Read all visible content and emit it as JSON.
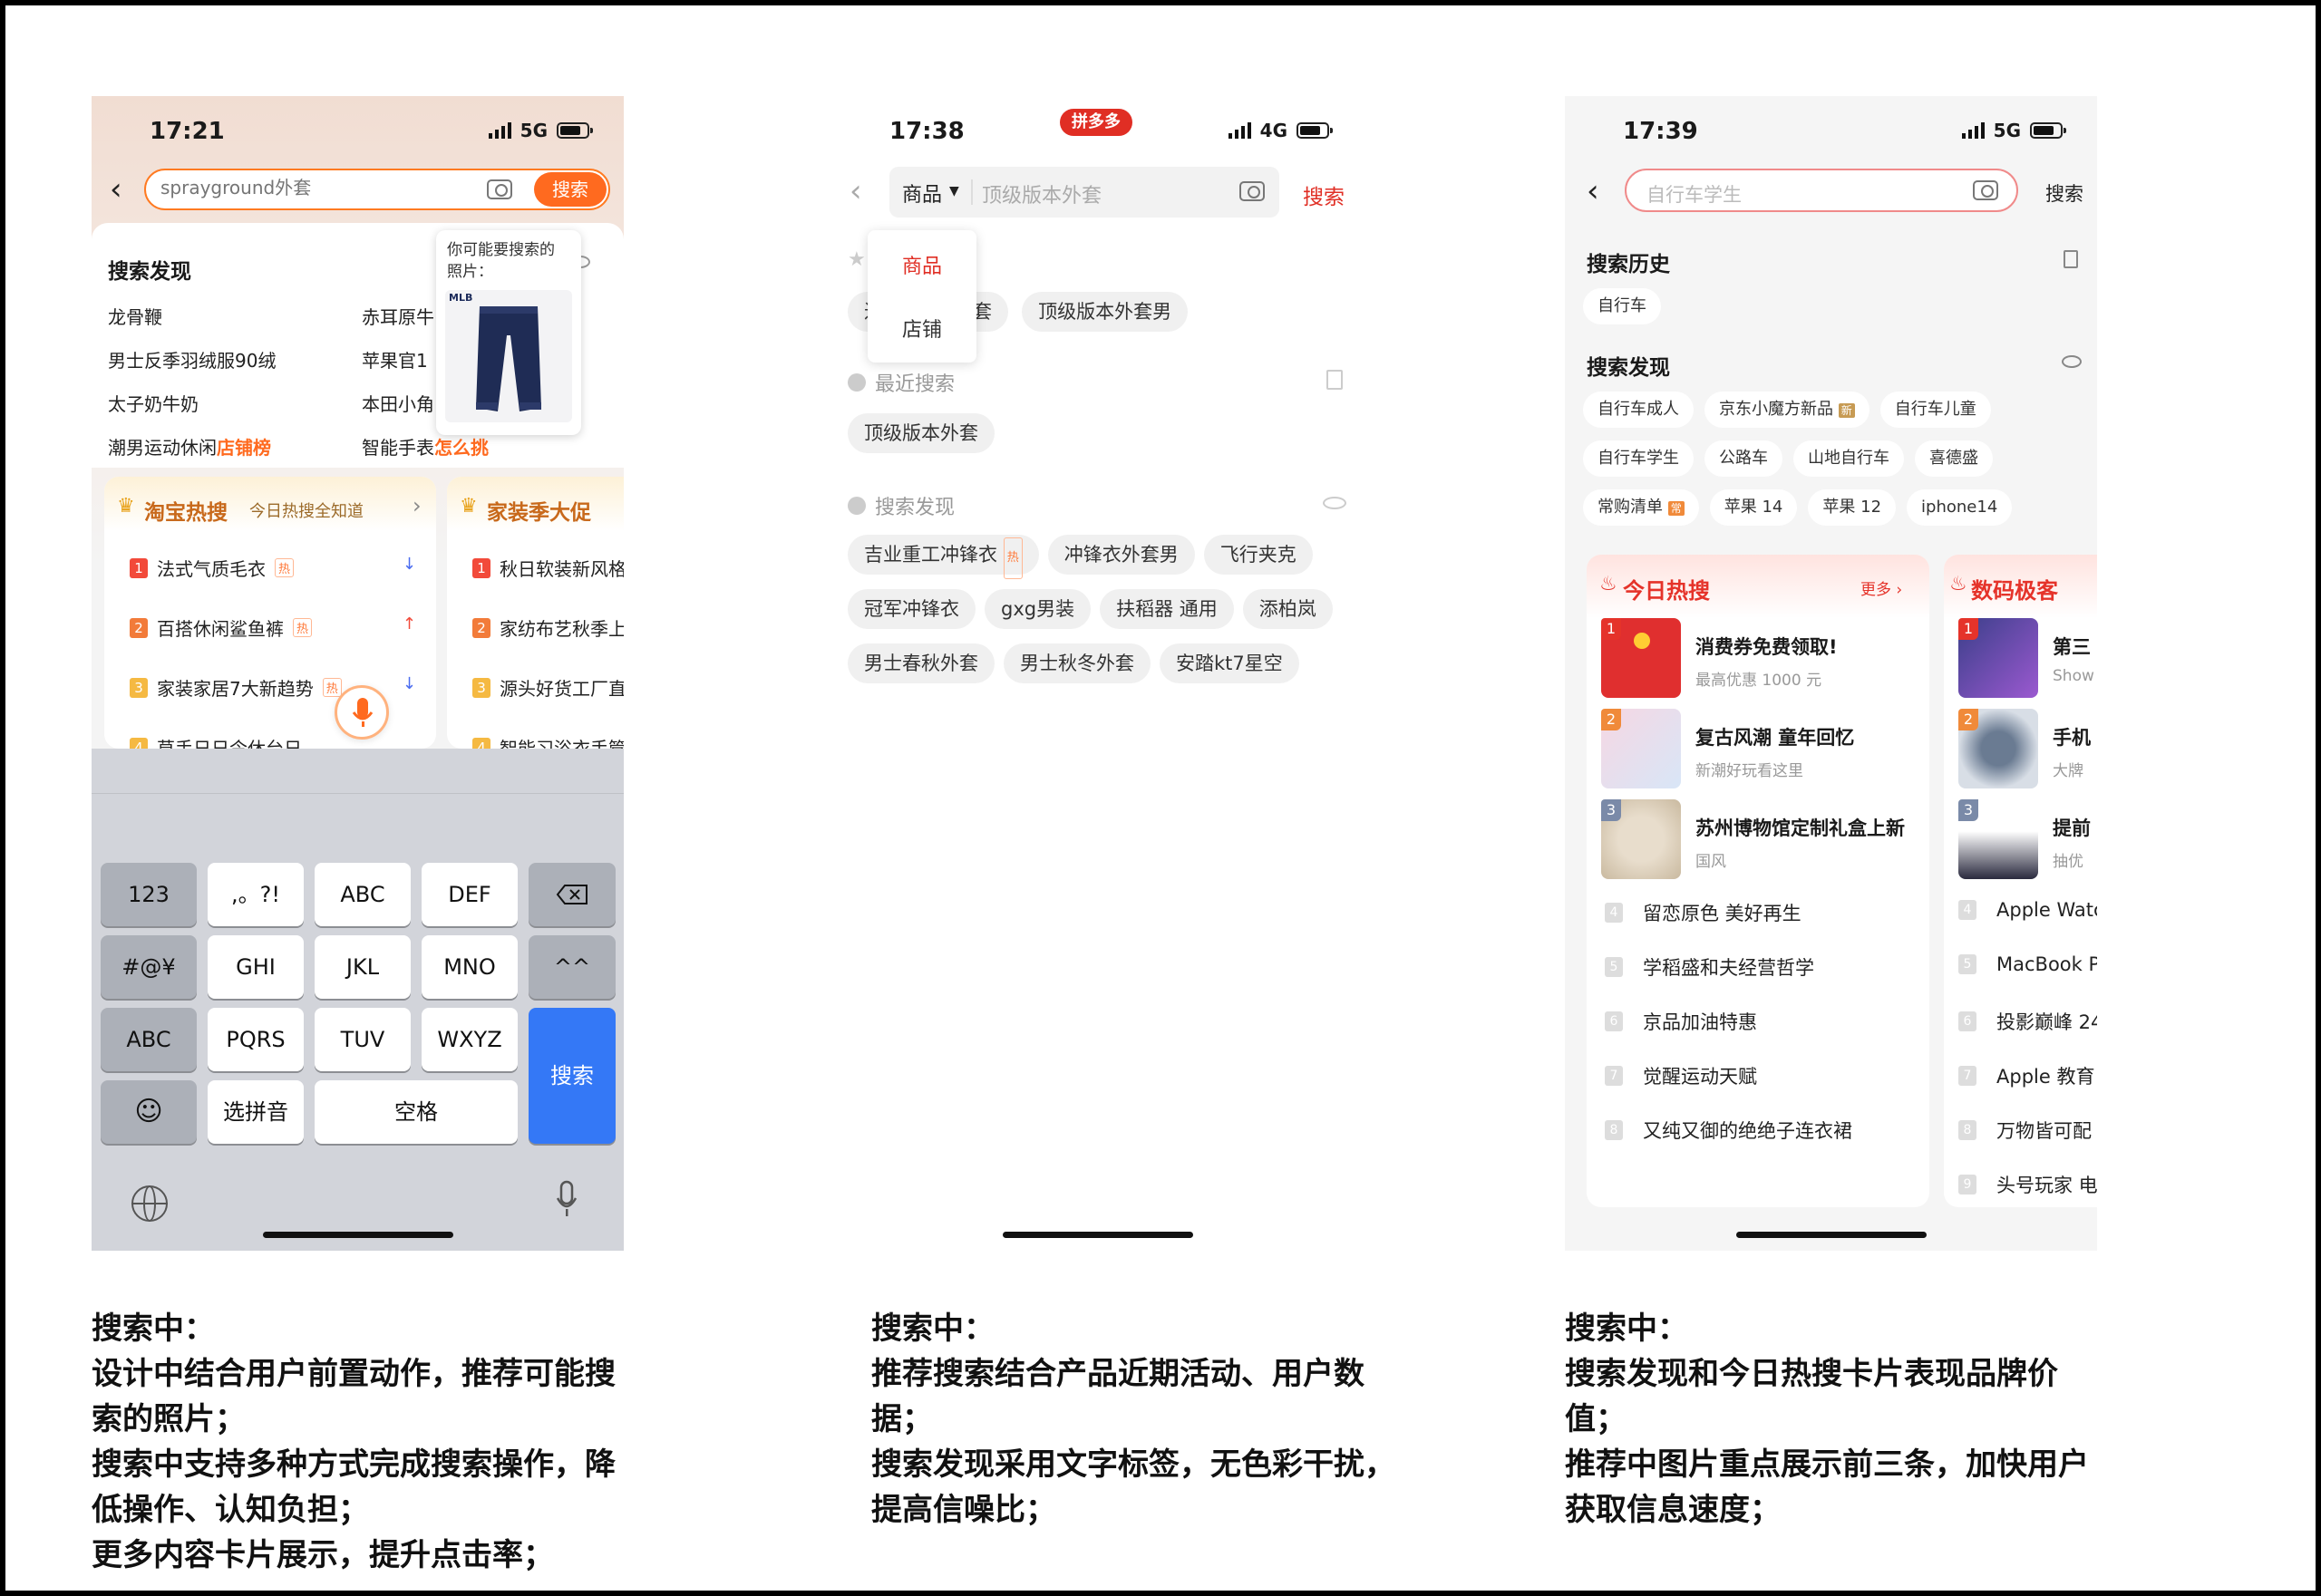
{
  "p1": {
    "time": "17:21",
    "network": "5G",
    "search_placeholder": "sprayground外套",
    "search_button": "搜索",
    "discover_title": "搜索发现",
    "discover_left": [
      "龙骨鞭",
      "男士反季羽绒服90绒",
      "太子奶牛奶",
      "潮男运动休闲"
    ],
    "discover_left_tag": "店铺榜",
    "discover_right": [
      "赤耳原牛",
      "苹果官1",
      "本田小角",
      "智能手表"
    ],
    "discover_right_tag": "怎么挑",
    "popup_text": "你可能要搜索的照片：",
    "popup_brand": "MLB",
    "hot1_title": "淘宝热搜",
    "hot1_subtitle": "今日热搜全知道",
    "hot1_items": [
      "法式气质毛衣",
      "百搭休闲鲨鱼裤",
      "家装家居7大新趋势",
      "草手日日令休台日"
    ],
    "hot_tag": "热",
    "hot2_title": "家装季大促",
    "hot2_items": [
      "秋日软装新风格",
      "家纺布艺秋季上",
      "源头好货工厂直",
      "智能习浴衣手管"
    ],
    "keyboard": {
      "r1": [
        "123",
        ",。?!",
        "ABC",
        "DEF"
      ],
      "r2": [
        "#@¥",
        "GHI",
        "JKL",
        "MNO",
        "^^"
      ],
      "r3": [
        "ABC",
        "PQRS",
        "TUV",
        "WXYZ"
      ],
      "r4_pinyin": "选拼音",
      "space": "空格",
      "search": "搜索"
    }
  },
  "p2": {
    "time": "17:38",
    "network": "4G",
    "brand_badge": "拼多多",
    "category": "商品",
    "search_placeholder": "顶级版本外套",
    "search_button": "搜索",
    "dropdown": [
      "商品",
      "店铺"
    ],
    "top_chips": [
      "近",
      "套",
      "顶级版本外套男"
    ],
    "recent_title": "最近搜索",
    "recent": [
      "顶级版本外套"
    ],
    "discover_title": "搜索发现",
    "discover_rows": [
      [
        "吉业重工冲锋衣",
        "冲锋衣外套男",
        "飞行夹克"
      ],
      [
        "冠军冲锋衣",
        "gxg男装",
        "扶稻器 通用",
        "添柏岚"
      ],
      [
        "男士春秋外套",
        "男士秋冬外套",
        "安踏kt7星空"
      ]
    ],
    "hot_tag": "热"
  },
  "p3": {
    "time": "17:39",
    "network": "5G",
    "search_placeholder": "自行车学生",
    "search_button": "搜索",
    "history_title": "搜索历史",
    "history": [
      "自行车"
    ],
    "discover_title": "搜索发现",
    "discover_rows": [
      [
        "自行车成人",
        "京东小魔方新品",
        "自行车儿童"
      ],
      [
        "自行车学生",
        "公路车",
        "山地自行车",
        "喜德盛"
      ],
      [
        "常购清单",
        "苹果 14",
        "苹果 12",
        "iphone14"
      ]
    ],
    "new_tag": "新",
    "card1_title": "今日热搜",
    "card1_more": "更多 ›",
    "card1_top": [
      {
        "title": "消费券免费领取!",
        "sub": "最高优惠 1000 元"
      },
      {
        "title": "复古风潮 童年回忆",
        "sub": "新潮好玩看这里"
      },
      {
        "title": "苏州博物馆定制礼盒上新",
        "sub": "国风"
      }
    ],
    "card1_rows": [
      "留恋原色 美好再生",
      "学稻盛和夫经营哲学",
      "京品加油特惠",
      "觉醒运动天赋",
      "又纯又御的绝绝子连衣裙"
    ],
    "card2_title": "数码极客",
    "card2_top": [
      {
        "title": "第三",
        "sub": "Show"
      },
      {
        "title": "手机",
        "sub": "大牌"
      },
      {
        "title": "提前",
        "sub": "抽优"
      }
    ],
    "card2_rows": [
      "Apple Watc",
      "MacBook P",
      "投影巅峰 24",
      "Apple 教育",
      "万物皆可配",
      "头号玩家 电"
    ]
  },
  "captions": {
    "c1": [
      "搜索中：",
      "设计中结合用户前置动作，推荐可能搜",
      "索的照片；",
      "搜索中支持多种方式完成搜索操作，降",
      "低操作、认知负担；",
      "更多内容卡片展示，提升点击率；"
    ],
    "c2": [
      "搜索中：",
      "推荐搜索结合产品近期活动、用户数",
      "据；",
      "搜索发现采用文字标签，无色彩干扰，",
      "提高信噪比；"
    ],
    "c3": [
      "搜索中：",
      "搜索发现和今日热搜卡片表现品牌价",
      "值；",
      "推荐中图片重点展示前三条，加快用户",
      "获取信息速度；"
    ]
  },
  "colors": {
    "accent_orange": "#ff6a1f",
    "jd_red": "#e5332a",
    "pdd_red": "#e02e24",
    "ios_blue": "#3478f6"
  }
}
